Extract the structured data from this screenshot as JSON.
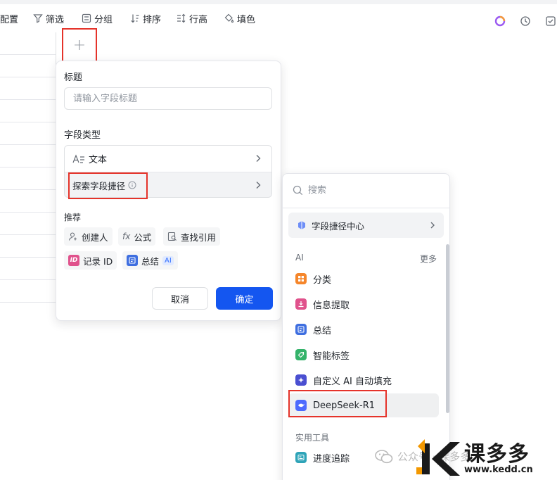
{
  "toolbar": {
    "config": "配置",
    "filter": "筛选",
    "group": "分组",
    "sort": "排序",
    "row_height": "行高",
    "fill_color": "填色"
  },
  "add_column": {
    "symbol": "+"
  },
  "field_panel": {
    "title_label": "标题",
    "title_placeholder": "请输入字段标题",
    "type_label": "字段类型",
    "type_value": "文本",
    "shortcut_label": "探索字段捷径",
    "recommend_label": "推荐",
    "recommend": [
      {
        "label": "创建人",
        "icon": "person-add-icon"
      },
      {
        "label": "公式",
        "icon": "formula-icon"
      },
      {
        "label": "查找引用",
        "icon": "lookup-icon"
      },
      {
        "label": "记录 ID",
        "icon": "id-icon"
      },
      {
        "label": "总结",
        "icon": "summary-icon",
        "tag": "AI"
      }
    ],
    "cancel": "取消",
    "confirm": "确定"
  },
  "shortcut_menu": {
    "search_placeholder": "搜索",
    "center": "字段捷径中心",
    "ai_section": "AI",
    "more": "更多",
    "ai_items": [
      {
        "label": "分类",
        "icon": "category-icon",
        "color": "#f5862b"
      },
      {
        "label": "信息提取",
        "icon": "extract-icon",
        "color": "#e0528c"
      },
      {
        "label": "总结",
        "icon": "summary-icon",
        "color": "#3f6fe0"
      },
      {
        "label": "智能标签",
        "icon": "tag-icon",
        "color": "#34b36a"
      },
      {
        "label": "自定义 AI 自动填充",
        "icon": "sparkle-icon",
        "color": "#4a4fd1"
      },
      {
        "label": "DeepSeek-R1",
        "icon": "deepseek-icon",
        "color": "#4d6bfe"
      }
    ],
    "tools_section": "实用工具",
    "tool_items": [
      {
        "label": "进度追踪",
        "icon": "progress-icon",
        "color": "#2fa4b8"
      }
    ]
  },
  "watermark": {
    "account": "公众号 · 课多多",
    "brand": "课多多",
    "url": "www.kedd.cn"
  },
  "colors": {
    "primary": "#1456f0",
    "highlight": "#e5332a"
  }
}
